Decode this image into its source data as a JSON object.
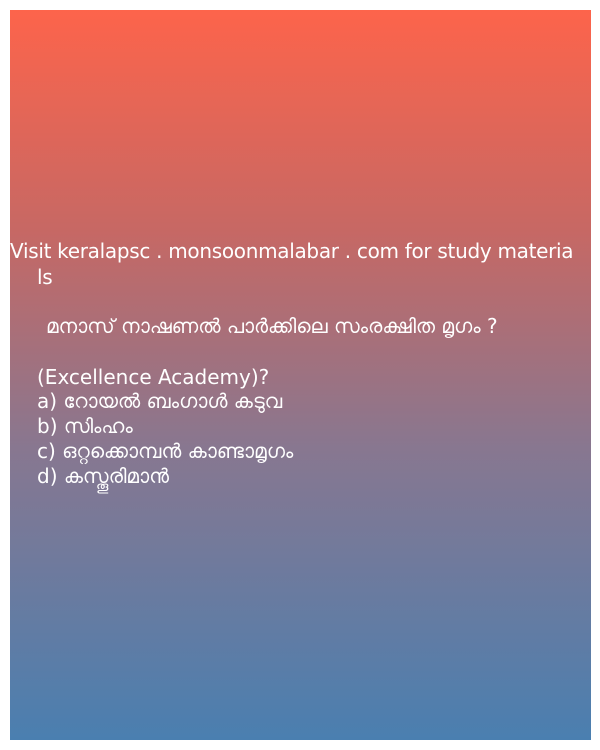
{
  "visit_line1": "Visit keralapsc . monsoonmalabar . com for study materia",
  "visit_line2": "ls",
  "question": "മനാസ് നാഷണൽ പാർക്കിലെ സംരക്ഷിത മൃഗം ?",
  "source": "(Excellence Academy)?",
  "options": [
    "a) റോയൽ ബംഗാൾ കടുവ",
    "b) സിംഹം",
    "c) ഒറ്റക്കൊമ്പൻ കാണ്ടാമൃഗം",
    "d) കസ്തൂരിമാൻ"
  ],
  "colors": {
    "gradient_top": "#fd644b",
    "gradient_bottom": "#4a7fb0",
    "text": "#ffffff"
  }
}
